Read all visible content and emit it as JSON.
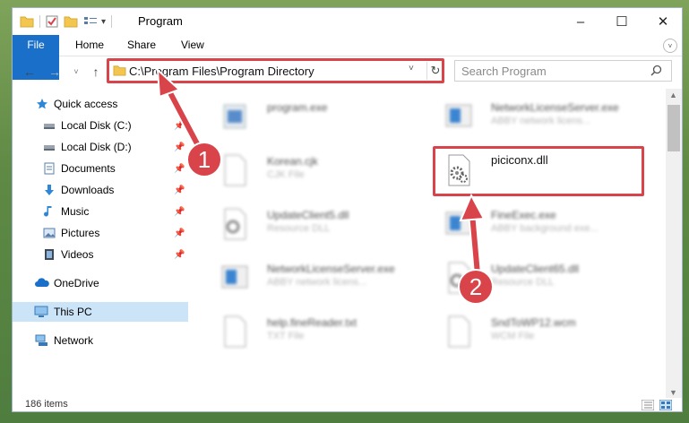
{
  "window": {
    "title": "Program"
  },
  "ribbon": {
    "tabs": [
      "File",
      "Home",
      "Share",
      "View"
    ],
    "expand": "˅"
  },
  "titlebar": {
    "minimize": "–",
    "maximize": "☐",
    "close": "✕"
  },
  "address": {
    "path": "C:\\Program Files\\Program Directory",
    "dropdown": "˅",
    "refresh": "↻"
  },
  "search": {
    "placeholder": "Search Program"
  },
  "nav": {
    "back": "←",
    "forward": "→",
    "recent": "˅",
    "up": "↑"
  },
  "sidebar": {
    "items": [
      {
        "label": "Quick access",
        "icon": "star-icon",
        "pinned": false
      },
      {
        "label": "Local Disk (C:)",
        "icon": "drive-icon",
        "pinned": true
      },
      {
        "label": "Local Disk (D:)",
        "icon": "drive-icon",
        "pinned": true
      },
      {
        "label": "Documents",
        "icon": "documents-icon",
        "pinned": true
      },
      {
        "label": "Downloads",
        "icon": "download-icon",
        "pinned": true
      },
      {
        "label": "Music",
        "icon": "music-icon",
        "pinned": true
      },
      {
        "label": "Pictures",
        "icon": "pictures-icon",
        "pinned": true
      },
      {
        "label": "Videos",
        "icon": "videos-icon",
        "pinned": true
      },
      {
        "label": "OneDrive",
        "icon": "cloud-icon",
        "pinned": false
      },
      {
        "label": "This PC",
        "icon": "pc-icon",
        "pinned": false,
        "selected": true
      },
      {
        "label": "Network",
        "icon": "network-icon",
        "pinned": false
      }
    ]
  },
  "files": [
    {
      "name": "program.exe",
      "desc": "",
      "icon": "app-icon"
    },
    {
      "name": "NetworkLicenseServer.exe",
      "desc": "ABBY network licens...",
      "icon": "app-icon"
    },
    {
      "name": "Korean.cjk",
      "desc": "CJK File",
      "icon": "file-icon"
    },
    {
      "name": "piciconx.dll",
      "desc": "",
      "icon": "dll-gear-icon"
    },
    {
      "name": "UpdateClient5.dll",
      "desc": "Resource DLL",
      "icon": "dll-gear-icon"
    },
    {
      "name": "FineExec.exe",
      "desc": "ABBY background exe...",
      "icon": "app-icon"
    },
    {
      "name": "NetworkLicenseServer.exe",
      "desc": "ABBY network licens...",
      "icon": "app-icon"
    },
    {
      "name": "UpdateClient65.dll",
      "desc": "Resource DLL",
      "icon": "dll-gear-icon"
    },
    {
      "name": "help.fineReader.txt",
      "desc": "TXT File",
      "icon": "file-icon"
    },
    {
      "name": "SndToWP12.wcm",
      "desc": "WCM File",
      "icon": "file-icon"
    }
  ],
  "status": {
    "count": "186 items"
  },
  "annotations": {
    "step1": "1",
    "step2": "2"
  },
  "colors": {
    "accent": "#1a6fc9",
    "highlight": "#d9434a",
    "selected": "#cce4f7"
  }
}
